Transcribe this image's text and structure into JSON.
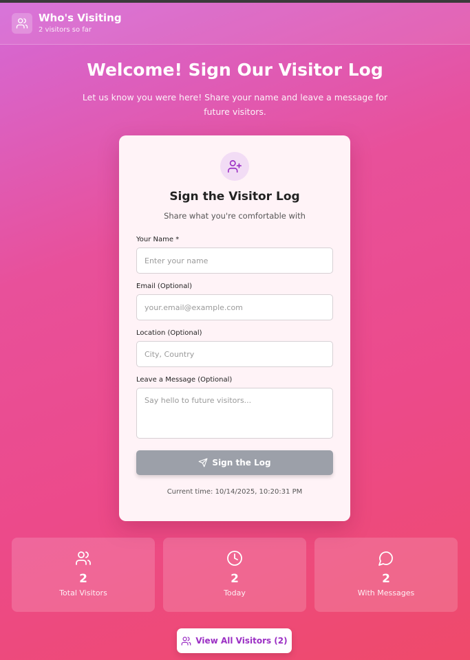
{
  "header": {
    "title": "Who's Visiting",
    "subtitle": "2 visitors so far",
    "icon": "users-icon"
  },
  "hero": {
    "title": "Welcome! Sign Our Visitor Log",
    "subtitle": "Let us know you were here! Share your name and leave a message for future visitors."
  },
  "form": {
    "icon": "user-plus-icon",
    "title": "Sign the Visitor Log",
    "subtitle": "Share what you're comfortable with",
    "name_label": "Your Name *",
    "name_placeholder": "Enter your name",
    "name_value": "",
    "email_label": "Email (Optional)",
    "email_placeholder": "your.email@example.com",
    "email_value": "",
    "location_label": "Location (Optional)",
    "location_placeholder": "City, Country",
    "location_value": "",
    "message_label": "Leave a Message (Optional)",
    "message_placeholder": "Say hello to future visitors...",
    "message_value": "",
    "submit_label": "Sign the Log",
    "submit_icon": "send-icon",
    "current_time": "Current time: 10/14/2025, 10:20:31 PM"
  },
  "stats": [
    {
      "icon": "users-icon",
      "value": "2",
      "label": "Total Visitors"
    },
    {
      "icon": "clock-icon",
      "value": "2",
      "label": "Today"
    },
    {
      "icon": "message-circle-icon",
      "value": "2",
      "label": "With Messages"
    }
  ],
  "view_all": {
    "label": "View All Visitors (2)",
    "icon": "users-icon"
  },
  "colors": {
    "accent": "#9b2fc4",
    "button_disabled": "#9ca0a9",
    "card_bg": "#fff3f7"
  }
}
